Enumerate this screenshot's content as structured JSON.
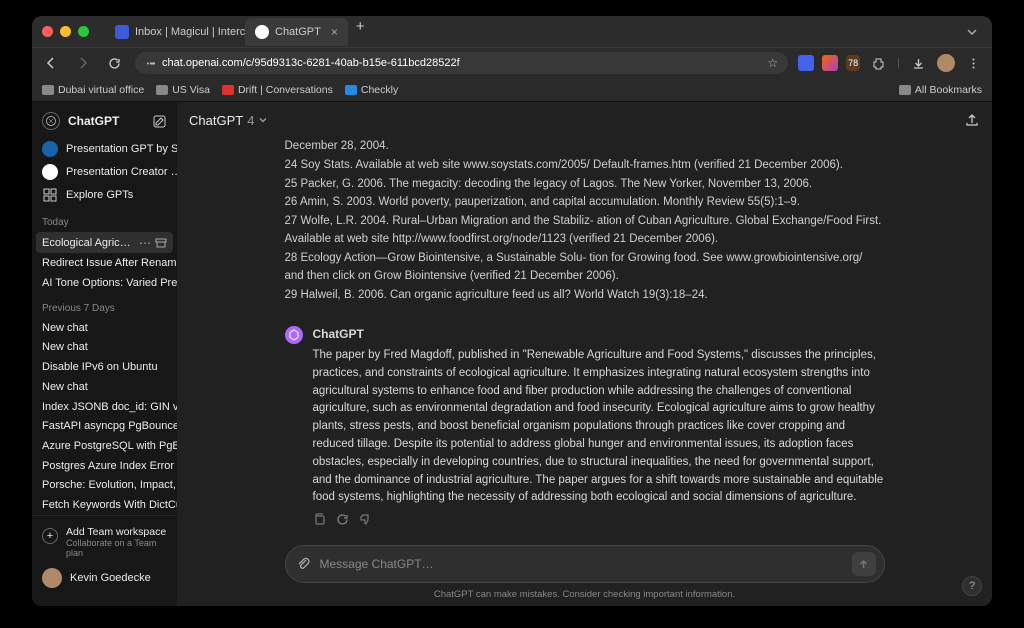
{
  "browser": {
    "tabs": [
      {
        "title": "Inbox | Magicul | Intercom",
        "active": false
      },
      {
        "title": "ChatGPT",
        "active": true
      }
    ],
    "url": "chat.openai.com/c/95d9313c-6281-40ab-b15e-611bcd28522f",
    "bookmarks": [
      {
        "label": "Dubai virtual office"
      },
      {
        "label": "US Visa"
      },
      {
        "label": "Drift | Conversations"
      },
      {
        "label": "Checkly"
      }
    ],
    "allBookmarks": "All Bookmarks",
    "extBadge": "78"
  },
  "sidebar": {
    "appName": "ChatGPT",
    "pinned": [
      {
        "label": "Presentation GPT by S…"
      },
      {
        "label": "Presentation Creator …"
      }
    ],
    "explore": "Explore GPTs",
    "sections": [
      {
        "title": "Today",
        "chats": [
          {
            "label": "Ecological Agriculture Ov…",
            "active": true
          },
          {
            "label": "Redirect Issue After Renaming"
          },
          {
            "label": "AI Tone Options: Varied Presentat"
          }
        ]
      },
      {
        "title": "Previous 7 Days",
        "chats": [
          {
            "label": "New chat"
          },
          {
            "label": "New chat"
          },
          {
            "label": "Disable IPv6 on Ubuntu"
          },
          {
            "label": "New chat"
          },
          {
            "label": "Index JSONB doc_id: GIN vs. BTRE"
          },
          {
            "label": "FastAPI asyncpg PgBouncer solut"
          },
          {
            "label": "Azure PostgreSQL with PgBounce"
          },
          {
            "label": "Postgres Azure Index Error"
          },
          {
            "label": "Porsche: Evolution, Impact, Future"
          },
          {
            "label": "Fetch Keywords With DictCursor"
          }
        ]
      }
    ],
    "addTeam": {
      "title": "Add Team workspace",
      "sub": "Collaborate on a Team plan"
    },
    "user": "Kevin Goedecke"
  },
  "header": {
    "modelName": "ChatGPT",
    "modelVer": "4"
  },
  "refs": [
    "December 28, 2004.",
    "24 Soy Stats. Available at web site www.soystats.com/2005/ Default-frames.htm (verified 21 December 2006).",
    "25 Packer, G. 2006. The megacity: decoding the legacy of Lagos. The New Yorker, November 13, 2006.",
    "26 Amin, S. 2003. World poverty, pauperization, and capital accumulation. Monthly Review 55(5):1–9.",
    "27 Wolfe, L.R. 2004. Rural–Urban Migration and the Stabiliz- ation of Cuban Agriculture. Global Exchange/Food First. Available at web site http://www.foodfirst.org/node/1123 (verified 21 December 2006).",
    "28 Ecology Action—Grow Biointensive, a Sustainable Solu- tion for Growing food. See www.growbiointensive.org/ and then click on Grow Biointensive (verified 21 December 2006).",
    "29 Halweil, B. 2006. Can organic agriculture feed us all? World Watch 19(3):18–24."
  ],
  "assistant": {
    "name": "ChatGPT",
    "text": "The paper by Fred Magdoff, published in \"Renewable Agriculture and Food Systems,\" discusses the principles, practices, and constraints of ecological agriculture. It emphasizes integrating natural ecosystem strengths into agricultural systems to enhance food and fiber production while addressing the challenges of conventional agriculture, such as environmental degradation and food insecurity. Ecological agriculture aims to grow healthy plants, stress pests, and boost beneficial organism populations through practices like cover cropping and reduced tillage. Despite its potential to address global hunger and environmental issues, its adoption faces obstacles, especially in developing countries, due to structural inequalities, the need for governmental support, and the dominance of industrial agriculture. The paper argues for a shift towards more sustainable and equitable food systems, highlighting the necessity of addressing both ecological and social dimensions of agriculture."
  },
  "composer": {
    "placeholder": "Message ChatGPT…"
  },
  "footer": "ChatGPT can make mistakes. Consider checking important information.",
  "help": "?"
}
